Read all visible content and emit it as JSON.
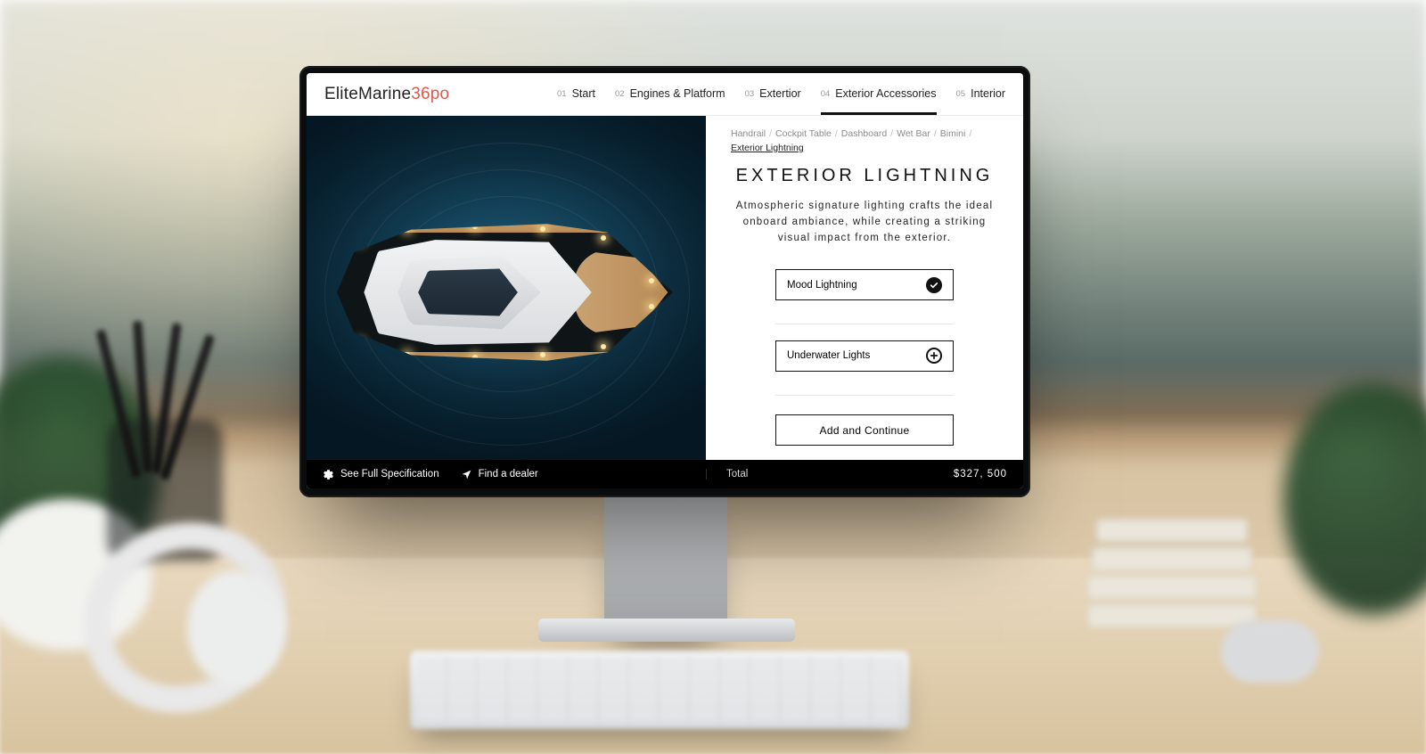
{
  "brand": {
    "name": "EliteMarine",
    "model": "36po"
  },
  "tabs": [
    {
      "num": "01",
      "label": "Start"
    },
    {
      "num": "02",
      "label": "Engines & Platform"
    },
    {
      "num": "03",
      "label": "Extertior"
    },
    {
      "num": "04",
      "label": "Exterior Accessories"
    },
    {
      "num": "05",
      "label": "Interior"
    }
  ],
  "activeTabIndex": 3,
  "breadcrumbs": {
    "items": [
      "Handrail",
      "Cockpit Table",
      "Dashboard",
      "Wet Bar",
      "Bimini",
      "Exterior Lightning"
    ],
    "currentIndex": 5
  },
  "section": {
    "title": "EXTERIOR LIGHTNING",
    "description": "Atmospheric signature lighting crafts the ideal onboard ambiance, while creating a striking visual impact from the exterior."
  },
  "options": [
    {
      "label": "Mood Lightning",
      "state": "selected"
    },
    {
      "label": "Underwater Lights",
      "state": "add"
    }
  ],
  "cta": "Add and Continue",
  "footer": {
    "spec": "See Full Specification",
    "dealer": "Find a dealer",
    "totalLabel": "Total",
    "totalValue": "$327, 500"
  }
}
